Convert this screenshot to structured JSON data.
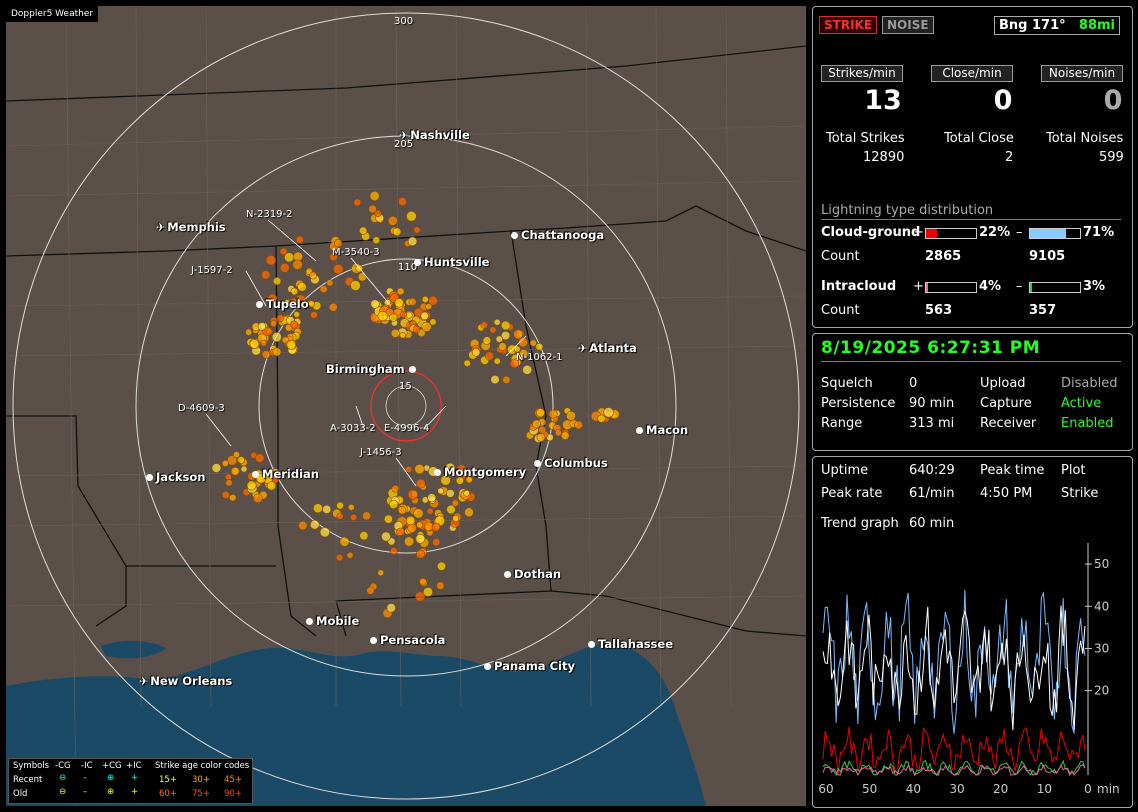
{
  "app_title": "Doppler5 Weather",
  "map": {
    "ring_labels": {
      "outer": "300",
      "mid": "205",
      "mid2": "110",
      "inner": "15"
    },
    "cities": [
      {
        "name": "Nashville",
        "icon": "plane"
      },
      {
        "name": "Memphis",
        "icon": "plane"
      },
      {
        "name": "Chattanooga",
        "icon": "dot"
      },
      {
        "name": "Huntsville",
        "icon": "dot"
      },
      {
        "name": "Tupelo",
        "icon": "dot"
      },
      {
        "name": "Atlanta",
        "icon": "plane"
      },
      {
        "name": "Birmingham",
        "icon": "dot"
      },
      {
        "name": "Macon",
        "icon": "dot"
      },
      {
        "name": "Columbus",
        "icon": "dot"
      },
      {
        "name": "Montgomery",
        "icon": "dot"
      },
      {
        "name": "Meridian",
        "icon": "dot"
      },
      {
        "name": "Jackson",
        "icon": "dot"
      },
      {
        "name": "Dothan",
        "icon": "dot"
      },
      {
        "name": "Mobile",
        "icon": "dot"
      },
      {
        "name": "Pensacola",
        "icon": "dot"
      },
      {
        "name": "Tallahassee",
        "icon": "dot"
      },
      {
        "name": "Panama City",
        "icon": "dot"
      },
      {
        "name": "New Orleans",
        "icon": "plane"
      }
    ],
    "storm_labels": [
      "N-2319-2",
      "M-3540-3",
      "J-1597-2",
      "N-1062-1",
      "D-4609-3",
      "A-3033-2",
      "E-4996-4",
      "J-1456-3"
    ]
  },
  "legend": {
    "symbols_label": "Symbols",
    "cols": [
      "-CG",
      "-IC",
      "+CG",
      "+IC"
    ],
    "age_label": "Strike age color codes",
    "recent_label": "Recent",
    "old_label": "Old",
    "recent_ages": [
      "15+",
      "30+",
      "45+"
    ],
    "old_ages": [
      "60+",
      "75+",
      "90+"
    ]
  },
  "status": {
    "strike_btn": "STRIKE",
    "noise_btn": "NOISE",
    "bearing": "Bng 171°",
    "distance": "88mi",
    "headers": [
      "Strikes/min",
      "Close/min",
      "Noises/min"
    ],
    "rates": [
      "13",
      "0",
      "0"
    ],
    "totals_labels": [
      "Total Strikes",
      "Total Close",
      "Total Noises"
    ],
    "totals": [
      "12890",
      "2",
      "599"
    ],
    "dist_title": "Lightning type distribution",
    "cg_label": "Cloud-ground",
    "cg_pos_pct": "22%",
    "cg_neg_pct": "71%",
    "count_label": "Count",
    "cg_pos_count": "2865",
    "cg_neg_count": "9105",
    "ic_label": "Intracloud",
    "ic_pos_pct": "4%",
    "ic_neg_pct": "3%",
    "ic_pos_count": "563",
    "ic_neg_count": "357",
    "plus": "+",
    "minus": "–"
  },
  "bar_levels": {
    "cg_pos": 0.22,
    "cg_neg": 0.71,
    "ic_pos": 0.04,
    "ic_neg": 0.03
  },
  "settings": {
    "datetime": "8/19/2025 6:27:31 PM",
    "squelch_label": "Squelch",
    "squelch": "0",
    "persistence_label": "Persistence",
    "persistence": "90 min",
    "range_label": "Range",
    "range": "313 mi",
    "upload_label": "Upload",
    "upload": "Disabled",
    "capture_label": "Capture",
    "capture": "Active",
    "receiver_label": "Receiver",
    "receiver": "Enabled"
  },
  "trend": {
    "uptime_label": "Uptime",
    "uptime": "640:29",
    "peak_time_label": "Peak time",
    "peak_time": "4:50 PM",
    "plot_label": "Plot",
    "plot": "Strike",
    "peak_rate_label": "Peak rate",
    "peak_rate": "61/min",
    "trend_label": "Trend graph",
    "trend_value": "60 min",
    "y_ticks": [
      "50",
      "40",
      "30",
      "20"
    ],
    "x_ticks": [
      "60",
      "50",
      "40",
      "30",
      "20",
      "10",
      "0"
    ],
    "x_unit": "min"
  },
  "colors": {
    "map_bg": "#5b5049",
    "water": "#1b4a66",
    "strike_old": "#ffd200",
    "strike_mid": "#ff8a00",
    "strike_recent": "#ff5a00",
    "green": "#22ff22"
  }
}
